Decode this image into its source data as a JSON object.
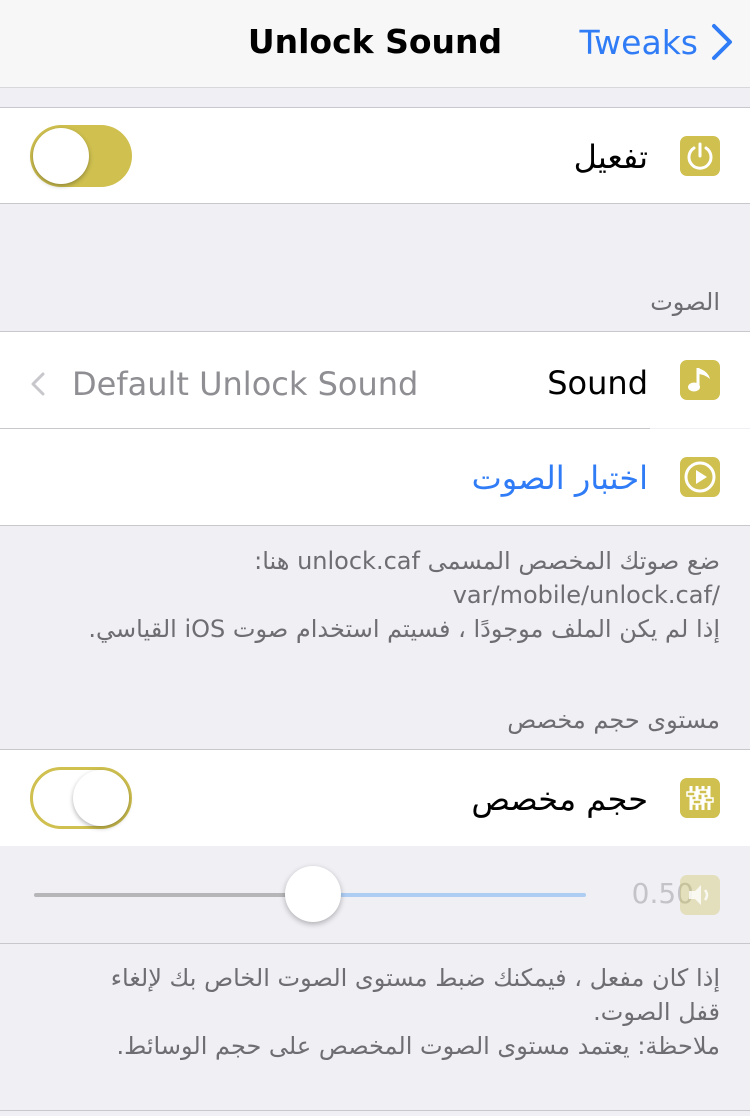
{
  "nav": {
    "title": "Unlock Sound",
    "back_label": "Tweaks"
  },
  "enable": {
    "label": "تفعيل",
    "enabled": true,
    "icon": "power-icon"
  },
  "sound_section": {
    "header": "الصوت",
    "sound_label": "Sound",
    "sound_value": "Default Unlock Sound",
    "test_label": "اختبار الصوت",
    "footer": [
      "ضع صوتك المخصص المسمى unlock.caf هنا:",
      "/var/mobile/unlock.caf",
      "إذا لم يكن الملف موجودًا ، فسيتم استخدام صوت iOS القياسي."
    ]
  },
  "volume_section": {
    "header": "مستوى حجم مخصص",
    "custom_label": "حجم مخصص",
    "custom_enabled": false,
    "slider_value": 0.5,
    "slider_display": "0.50",
    "footer": [
      "إذا كان مفعل ، فيمكنك ضبط مستوى الصوت الخاص بك لإلغاء",
      "قفل الصوت.",
      "ملاحظة: يعتمد مستوى الصوت المخصص على حجم الوسائط."
    ]
  },
  "colors": {
    "accent": "#cfc04f",
    "link": "#2f7cf6"
  }
}
